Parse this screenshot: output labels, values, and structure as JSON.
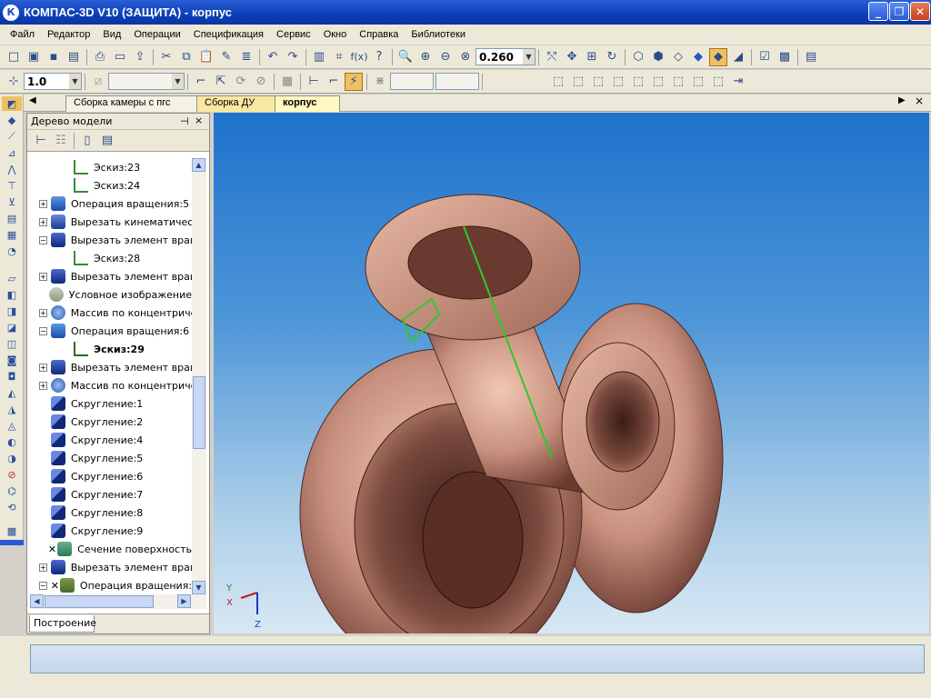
{
  "window": {
    "app_icon": "К",
    "title": "КОМПАС-3D V10 (ЗАЩИТА) - корпус"
  },
  "menu": [
    "Файл",
    "Редактор",
    "Вид",
    "Операции",
    "Спецификация",
    "Сервис",
    "Окно",
    "Справка",
    "Библиотеки"
  ],
  "toolbar": {
    "zoom_value": "0.260",
    "step_value": "1.0"
  },
  "tabs": [
    "Сборка камеры с пгс",
    "Сборка ДУ",
    "корпус"
  ],
  "tree": {
    "title": "Дерево модели",
    "footer_tab": "Построение",
    "items": [
      {
        "label": "Эскиз:23",
        "type": "sketch",
        "expander": ""
      },
      {
        "label": "Эскиз:24",
        "type": "sketch",
        "expander": ""
      },
      {
        "label": "Операция вращения:5",
        "type": "rotate",
        "expander": "+"
      },
      {
        "label": "Вырезать кинематичес",
        "type": "cut-kin",
        "expander": "+"
      },
      {
        "label": "Вырезать элемент вращ",
        "type": "cut",
        "expander": "−"
      },
      {
        "label": "Эскиз:28",
        "type": "sketch",
        "expander": ""
      },
      {
        "label": "Вырезать элемент вращ",
        "type": "cut",
        "expander": "+"
      },
      {
        "label": "Условное изображение",
        "type": "thread",
        "expander": ""
      },
      {
        "label": "Массив по концентриче",
        "type": "array",
        "expander": "+"
      },
      {
        "label": "Операция вращения:6",
        "type": "rotate",
        "expander": "−"
      },
      {
        "label": "Эскиз:29",
        "type": "sketch-active",
        "expander": ""
      },
      {
        "label": "Вырезать элемент вращ",
        "type": "cut",
        "expander": "+"
      },
      {
        "label": "Массив по концентриче",
        "type": "array",
        "expander": "+"
      },
      {
        "label": "Скругление:1",
        "type": "fillet",
        "expander": ""
      },
      {
        "label": "Скругление:2",
        "type": "fillet",
        "expander": ""
      },
      {
        "label": "Скругление:4",
        "type": "fillet",
        "expander": ""
      },
      {
        "label": "Скругление:5",
        "type": "fillet",
        "expander": ""
      },
      {
        "label": "Скругление:6",
        "type": "fillet",
        "expander": ""
      },
      {
        "label": "Скругление:7",
        "type": "fillet",
        "expander": ""
      },
      {
        "label": "Скругление:8",
        "type": "fillet",
        "expander": ""
      },
      {
        "label": "Скругление:9",
        "type": "fillet",
        "expander": ""
      },
      {
        "label": "Сечение поверхность",
        "type": "section-error",
        "expander": ""
      },
      {
        "label": "Вырезать элемент вращ",
        "type": "cut",
        "expander": "+"
      },
      {
        "label": "Операция вращения:",
        "type": "rotate-error",
        "expander": "−"
      }
    ]
  },
  "axes": {
    "y": "Y",
    "x": "X",
    "z": "Z"
  },
  "colors": {
    "titlebar": "#0a3fb8",
    "chrome": "#ece9d8",
    "model": "#c8907e",
    "model_dark": "#7a4a3e",
    "sketch_line": "#2ec82e"
  }
}
